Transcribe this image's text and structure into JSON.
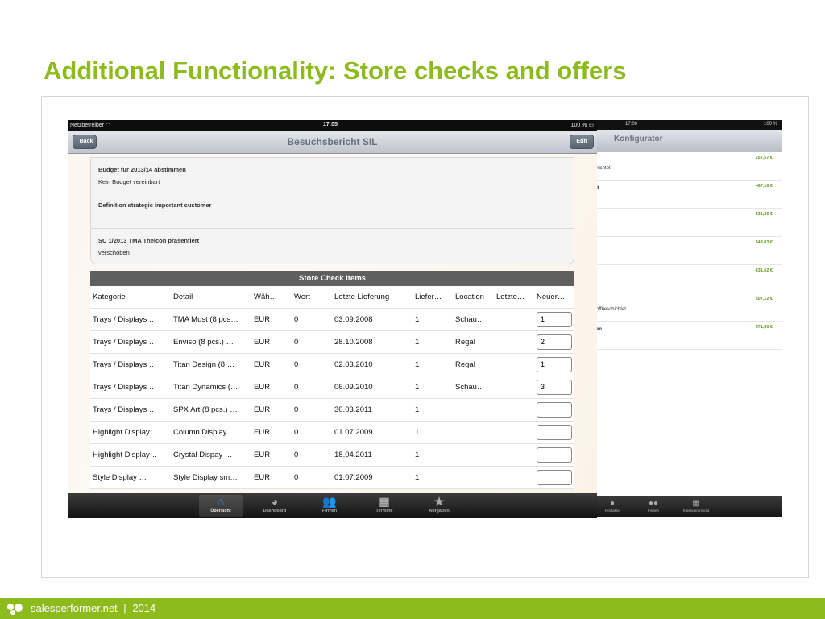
{
  "slide": {
    "title": "Additional Functionality: Store checks and offers"
  },
  "footer": {
    "brand": "salesperformer.net",
    "separator": "|",
    "year": "2014"
  },
  "tablet_back": {
    "status_time": "17:00",
    "status_battery": "100 %",
    "nav_title": "Konfigurator",
    "rows": [
      {
        "label": "",
        "label_top": "",
        "amount": "257,57 €",
        "sub": "hichtet"
      },
      {
        "label": "",
        "label_top": "lt",
        "amount": "467,16 €",
        "sub": ""
      },
      {
        "label": "",
        "label_top": "",
        "amount": "531,26 €",
        "sub": ""
      },
      {
        "label": "",
        "label_top": "",
        "amount": "548,83 €",
        "sub": ""
      },
      {
        "label": "",
        "label_top": "",
        "amount": "631,62 €",
        "sub": ""
      },
      {
        "label": "",
        "label_top": "",
        "amount": "507,12 €",
        "sub": "offbeschichtet"
      },
      {
        "label": "",
        "label_top": "en",
        "amount": "571,60 €",
        "sub": ""
      }
    ],
    "tabs": [
      "Kontakte",
      "Firmen",
      "Kalenderansicht"
    ]
  },
  "tablet_front": {
    "status": {
      "carrier": "Netzbetreiber",
      "time": "17:05",
      "battery": "100 %"
    },
    "nav": {
      "back": "Back",
      "title": "Besuchsbericht SIL",
      "edit": "Edit"
    },
    "notes": [
      {
        "heading": "Budget für 2013/14 abstimmen",
        "value": "Kein Budget vereinbart"
      },
      {
        "heading": "Definition strategic important customer",
        "value": ""
      },
      {
        "heading": "SC 1/2013 TMA Thelcon präsentiert",
        "value": "verschoben"
      }
    ],
    "store_check": {
      "title": "Store Check Items",
      "columns": [
        "Kategorie",
        "Detail",
        "Wäh…",
        "Wert",
        "Letzte Lieferung",
        "Liefer…",
        "Location",
        "Letzte…",
        "Neuer…"
      ],
      "rows": [
        {
          "kategorie": "Trays / Displays …",
          "detail": "TMA Must (8 pcs…",
          "waehrung": "EUR",
          "wert": "0",
          "letzte_lieferung": "03.09.2008",
          "liefer": "1",
          "location": "Schau…",
          "letzte": "",
          "neuer": "1"
        },
        {
          "kategorie": "Trays / Displays …",
          "detail": "Enviso (8 pcs.)  …",
          "waehrung": "EUR",
          "wert": "0",
          "letzte_lieferung": "28.10.2008",
          "liefer": "1",
          "location": "Regal",
          "letzte": "",
          "neuer": "2"
        },
        {
          "kategorie": "Trays / Displays …",
          "detail": "Titan Design (8 …",
          "waehrung": "EUR",
          "wert": "0",
          "letzte_lieferung": "02.03.2010",
          "liefer": "1",
          "location": "Regal",
          "letzte": "",
          "neuer": "1"
        },
        {
          "kategorie": "Trays / Displays …",
          "detail": "Titan Dynamics (…",
          "waehrung": "EUR",
          "wert": "0",
          "letzte_lieferung": "06.09.2010",
          "liefer": "1",
          "location": "Schau…",
          "letzte": "",
          "neuer": "3"
        },
        {
          "kategorie": "Trays / Displays …",
          "detail": "SPX Art (8 pcs.) …",
          "waehrung": "EUR",
          "wert": "0",
          "letzte_lieferung": "30.03.2011",
          "liefer": "1",
          "location": "",
          "letzte": "",
          "neuer": ""
        },
        {
          "kategorie": "Highlight Display…",
          "detail": "Column Display  …",
          "waehrung": "EUR",
          "wert": "0",
          "letzte_lieferung": "01.07.2009",
          "liefer": "1",
          "location": "",
          "letzte": "",
          "neuer": ""
        },
        {
          "kategorie": "Highlight Display…",
          "detail": "Crystal Dispay    …",
          "waehrung": "EUR",
          "wert": "0",
          "letzte_lieferung": "18.04.2011",
          "liefer": "1",
          "location": "",
          "letzte": "",
          "neuer": ""
        },
        {
          "kategorie": "Style Display      …",
          "detail": "Style Display sm…",
          "waehrung": "EUR",
          "wert": "0",
          "letzte_lieferung": "01.07.2009",
          "liefer": "1",
          "location": "",
          "letzte": "",
          "neuer": ""
        }
      ]
    },
    "tabs": [
      {
        "label": "Übersicht",
        "icon": "home-icon",
        "glyph": "⌂",
        "active": true
      },
      {
        "label": "Dashboard",
        "icon": "pie-chart-icon",
        "glyph": "◕",
        "active": false
      },
      {
        "label": "Firmen",
        "icon": "people-icon",
        "glyph": "👥",
        "active": false
      },
      {
        "label": "Termine",
        "icon": "calendar-icon",
        "glyph": "▦",
        "active": false
      },
      {
        "label": "Aufgaben",
        "icon": "star-icon",
        "glyph": "★",
        "active": false
      }
    ]
  },
  "colors": {
    "brand_green": "#8dbb1d",
    "amount_green": "#5a9a12",
    "table_header": "#5f5f5f",
    "active_tab": "#3b8ee6"
  }
}
